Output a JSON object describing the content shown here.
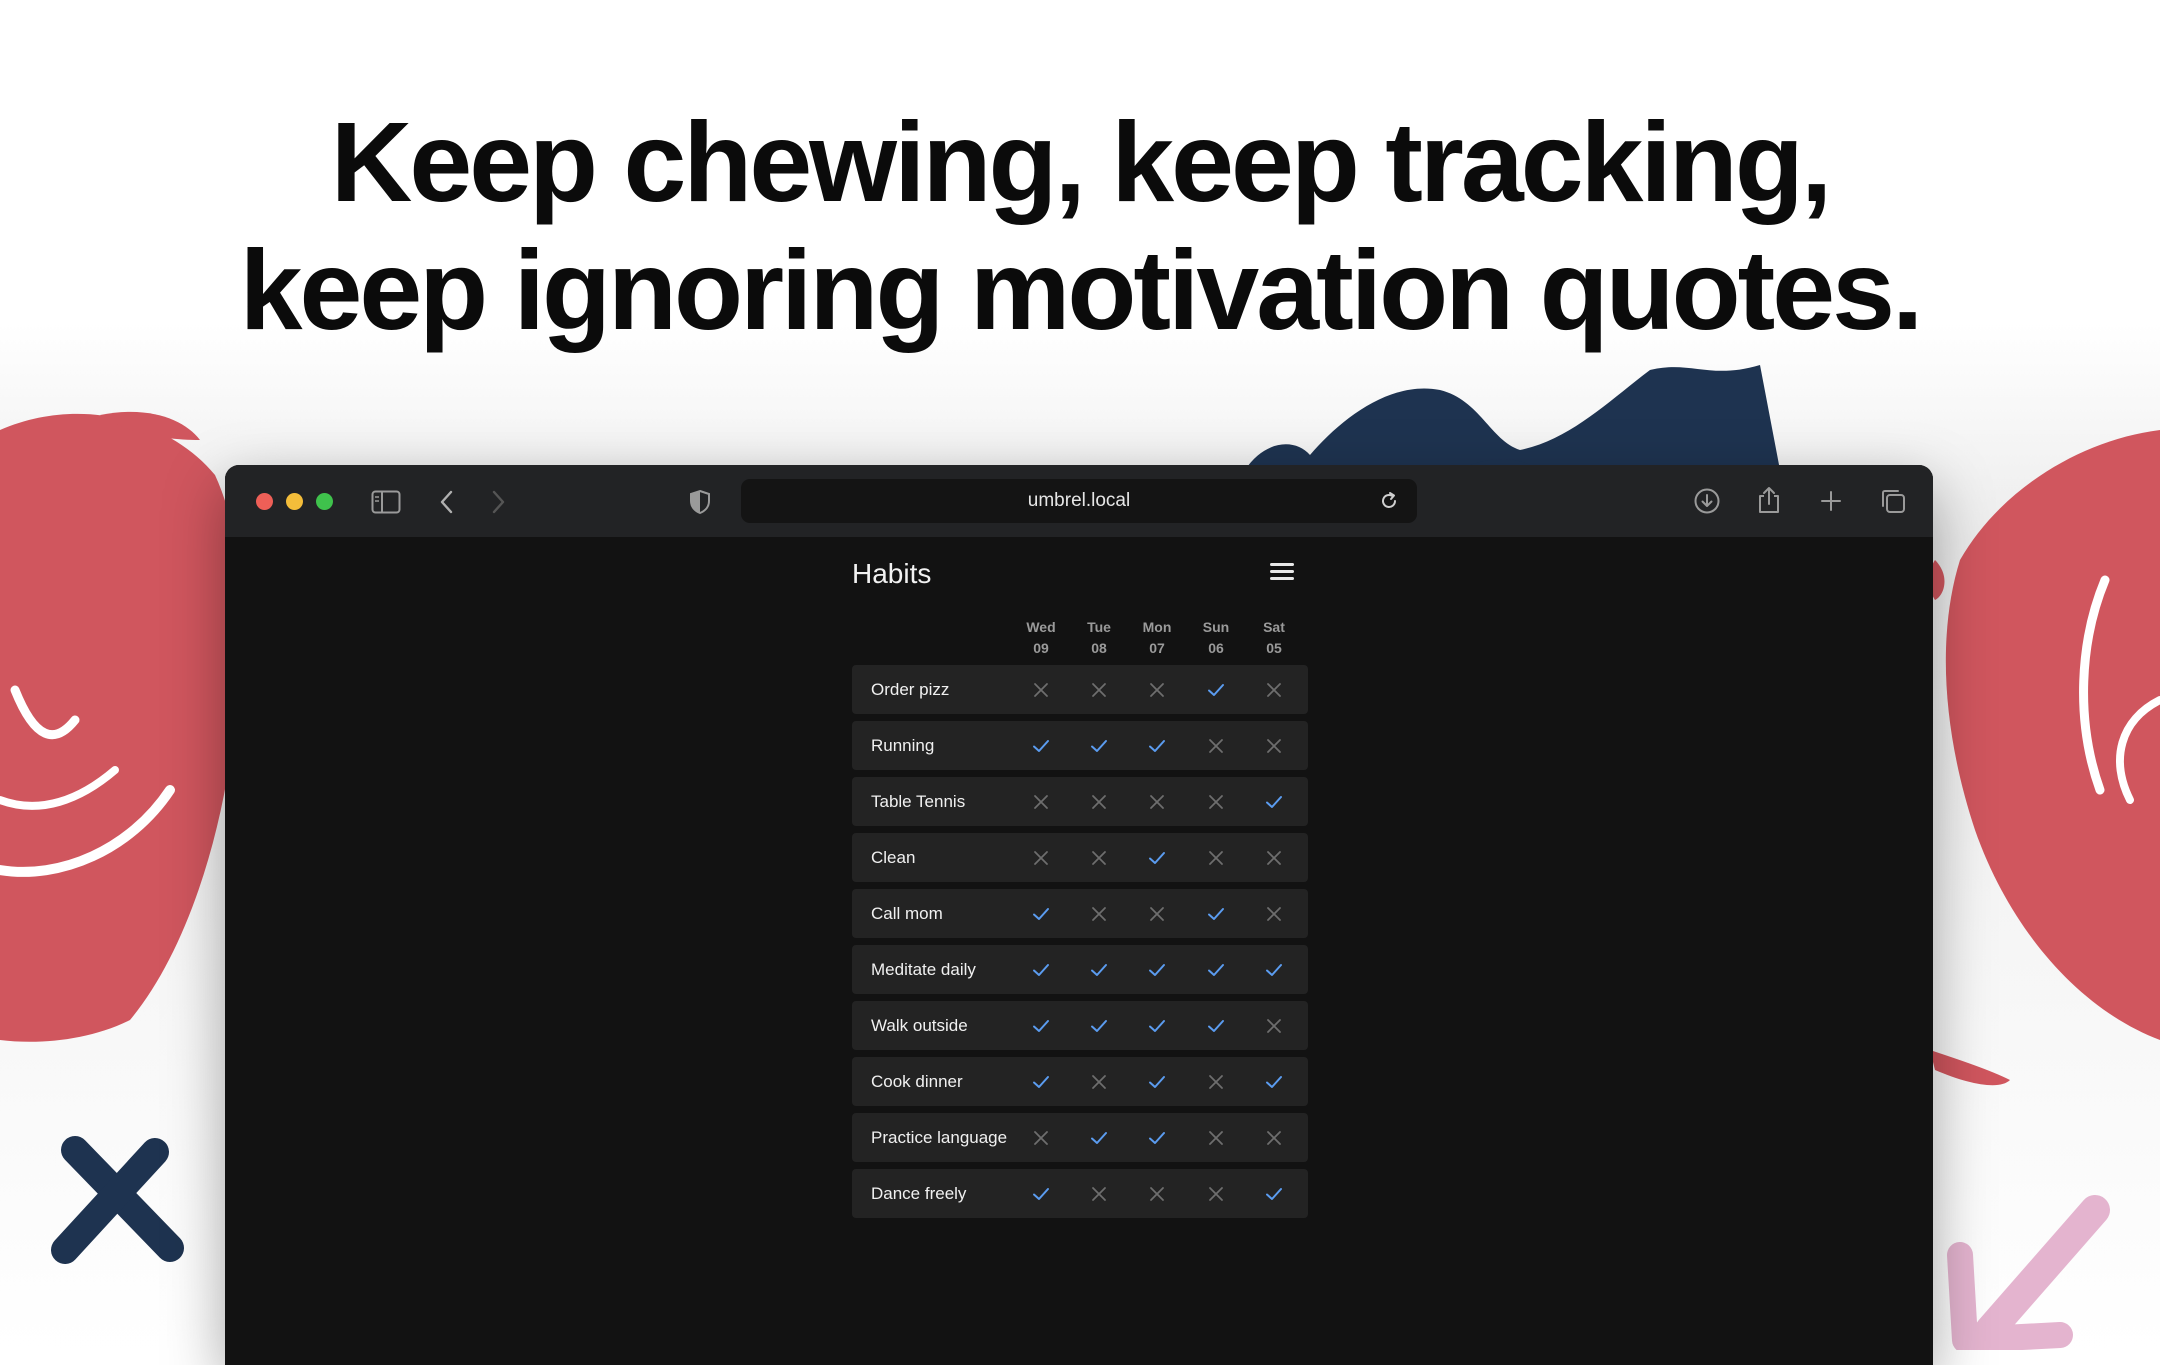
{
  "headline": {
    "line1": "Keep chewing, keep tracking,",
    "line2": "keep ignoring motivation quotes."
  },
  "browser": {
    "url": "umbrel.local",
    "icons": [
      "sidebar-icon",
      "back-icon",
      "forward-icon",
      "shield-icon",
      "reload-icon",
      "download-icon",
      "share-icon",
      "new-tab-icon",
      "tabs-overview-icon"
    ]
  },
  "app": {
    "title": "Habits",
    "menu_icon": "hamburger-menu-icon",
    "days": [
      {
        "dow": "Wed",
        "date": "09"
      },
      {
        "dow": "Tue",
        "date": "08"
      },
      {
        "dow": "Mon",
        "date": "07"
      },
      {
        "dow": "Sun",
        "date": "06"
      },
      {
        "dow": "Sat",
        "date": "05"
      }
    ],
    "habits": [
      {
        "name": "Order pizz",
        "checks": [
          false,
          false,
          false,
          true,
          false
        ]
      },
      {
        "name": "Running",
        "checks": [
          true,
          true,
          true,
          false,
          false
        ]
      },
      {
        "name": "Table Tennis",
        "checks": [
          false,
          false,
          false,
          false,
          true
        ]
      },
      {
        "name": "Clean",
        "checks": [
          false,
          false,
          true,
          false,
          false
        ]
      },
      {
        "name": "Call mom",
        "checks": [
          true,
          false,
          false,
          true,
          false
        ]
      },
      {
        "name": "Meditate daily",
        "checks": [
          true,
          true,
          true,
          true,
          true
        ]
      },
      {
        "name": "Walk outside",
        "checks": [
          true,
          true,
          true,
          true,
          false
        ]
      },
      {
        "name": "Cook dinner",
        "checks": [
          true,
          false,
          true,
          false,
          true
        ]
      },
      {
        "name": "Practice language",
        "checks": [
          false,
          true,
          true,
          false,
          false
        ]
      },
      {
        "name": "Dance freely",
        "checks": [
          true,
          false,
          false,
          false,
          true
        ]
      }
    ]
  },
  "colors": {
    "check": "#5b9cf0",
    "cross": "#6e6e6e",
    "accent_red": "#d0565e",
    "accent_navy": "#1e3350",
    "accent_pink": "#e4b4cf"
  }
}
